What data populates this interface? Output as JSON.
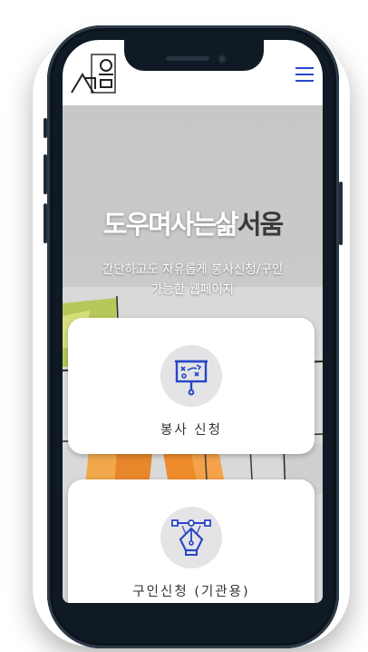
{
  "header": {
    "logo_icon": "seoum-logo",
    "menu_icon": "hamburger-menu-icon",
    "menu_color": "#2747c9"
  },
  "hero": {
    "title_light": "도우며사는삶",
    "title_dark": "서움",
    "subtitle_line1": "간단하고도 자유롭게 봉사신청/구인",
    "subtitle_line2": "가능한 웹페이지"
  },
  "cards": [
    {
      "label": "봉사 신청",
      "icon": "presentation-board-icon"
    },
    {
      "label": "구인신청 (기관용)",
      "icon": "pen-tool-icon"
    }
  ],
  "colors": {
    "accent": "#2747c9",
    "phone_frame": "#0f1a24"
  }
}
